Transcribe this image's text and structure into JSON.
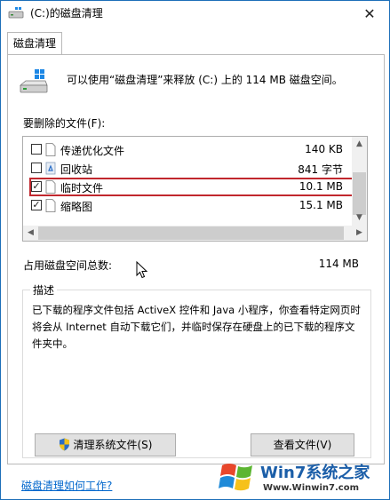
{
  "window": {
    "title": "(C:)的磁盘清理",
    "close_glyph": "✕"
  },
  "tabs": [
    {
      "label": "磁盘清理"
    }
  ],
  "summary": "可以使用“磁盘清理”来释放 (C:) 上的 114 MB 磁盘空间。",
  "files_label": "要删除的文件(F):",
  "files": [
    {
      "name": "传递优化文件",
      "size": "140 KB",
      "checked": false,
      "icon": "file-icon"
    },
    {
      "name": "回收站",
      "size": "841 字节",
      "checked": false,
      "icon": "recycle-bin-icon"
    },
    {
      "name": "临时文件",
      "size": "10.1 MB",
      "checked": true,
      "icon": "file-icon"
    },
    {
      "name": "缩略图",
      "size": "15.1 MB",
      "checked": true,
      "icon": "file-icon"
    }
  ],
  "total": {
    "label": "占用磁盘空间总数:",
    "value": "114 MB"
  },
  "description": {
    "label": "描述",
    "text": "已下载的程序文件包括 ActiveX 控件和 Java 小程序，你查看特定网页时将会从 Internet 自动下载它们，并临时保存在硬盘上的已下载的程序文件夹中。"
  },
  "buttons": {
    "clean_system": "清理系统文件(S)",
    "view_files": "查看文件(V)"
  },
  "help_link": "磁盘清理如何工作?",
  "watermark": {
    "brand": "Win7系统之家",
    "url": "Www.Winwin7.com"
  },
  "colors": {
    "highlight_border": "#c1272d",
    "link": "#0066cc",
    "window_border": "#1d6fb8"
  }
}
